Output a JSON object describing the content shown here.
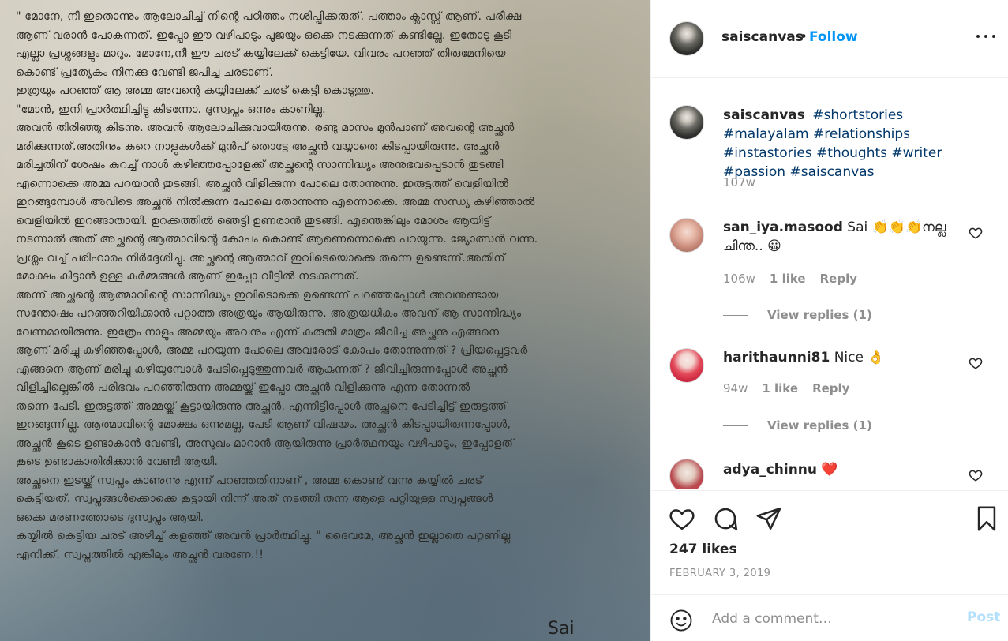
{
  "post": {
    "poem_lines": [
      "\" മോനേ, നീ ഇതൊന്നും ആലോചിച്ച് നിന്റെ പഠിത്തം നശിപ്പിക്കരുത്. പത്താം ക്ലാസ്സ് ആണ്. പരീക്ഷ",
      "ആണ് വരാൻ പോകുന്നത്. ഇപ്പോ ഈ വഴിപാടും പൂജയും ഒക്കെ നടക്കുന്നത് കണ്ടില്ലേ. ഇതോടു കൂടി",
      "എല്ലാ പ്രശ്നങ്ങളും മാറും. മോനേ,നീ ഈ ചരട് കയ്യിലേക്ക് കെട്ടിയേ. വിവരം പറഞ്ഞ് തിരുമേനിയെ",
      "കൊണ്ട് പ്രത്യേകം നിനക്കു വേണ്ടി ജപിച്ച ചരടാണ്.",
      "ഇത്രയും പറഞ്ഞ് ആ അമ്മ അവന്റെ കയ്യിലേക്ക് ചരട് കെട്ടി കൊടുത്തു.",
      "\"മോൻ, ഇനി പ്രാർത്ഥിച്ചിട്ടു കിടന്നോ. ദുസ്വപ്നം ഒന്നും കാണില്ല.",
      "അവൻ തിരിഞ്ഞു കിടന്നു. അവൻ ആലോചിക്കുവായിരുന്നു. രണ്ടു മാസം മുൻപാണ് അവന്റെ അച്ഛൻ",
      "മരിക്കുന്നത്.അതിനും കുറെ നാളുകൾക്ക് മുൻപ് തൊട്ടേ അച്ഛൻ വയ്യാതെ കിടപ്പായിരുന്നു. അച്ഛൻ",
      "മരിച്ചതിന് ശേഷം കുറച്ച് നാൾ കഴിഞ്ഞപ്പോളേക്ക് അച്ഛന്റെ സാന്നിദ്ധ്യം അനുഭവപ്പെടാൻ തുടങ്ങി",
      "എന്നൊക്കെ അമ്മ പറയാൻ തുടങ്ങി. അച്ഛൻ വിളിക്കുന്ന പോലെ തോന്നുന്നു. ഇരുട്ടത്ത് വെളിയിൽ",
      "ഇറങ്ങുമ്പോൾ അവിടെ അച്ഛൻ നിൽക്കുന്ന പോലെ തോന്നുന്നു എന്നൊക്കെ. അമ്മ സന്ധ്യ കഴിഞ്ഞാൽ",
      "വെളിയിൽ ഇറങ്ങാതായി. ഉറക്കത്തിൽ ഞെട്ടി ഉണരാൻ തുടങ്ങി. എന്തെങ്കിലും മോശം ആയിട്ട്",
      "നടന്നാൽ അത് അച്ഛന്റെ ആത്മാവിന്റെ കോപം കൊണ്ട് ആണെന്നൊക്കെ പറയുന്നു. ജ്യോത്സൻ വന്നു.",
      "പ്രശ്നം വച്ച് പരിഹാരം നിർദ്ദേശിച്ചു. അച്ഛന്റെ ആത്മാവ് ഇവിടെയൊക്കെ തന്നെ ഉണ്ടെന്ന്.അതിന്",
      "മോക്ഷം കിട്ടാൻ ഉള്ള കർമ്മങ്ങൾ ആണ് ഇപ്പോ വീട്ടിൽ നടക്കുന്നത്.",
      "അന്ന് അച്ഛന്റെ ആത്മാവിന്റെ സാന്നിദ്ധ്യം ഇവിടൊക്കെ ഉണ്ടെന്ന് പറഞ്ഞപ്പോൾ അവനുണ്ടായ",
      "സന്തോഷം പറഞ്ഞറിയിക്കാൻ പറ്റാത്ത അത്രയും ആയിരുന്നു. അത്രയധികം അവന് ആ സാന്നിദ്ധ്യം",
      "വേണമായിരുന്നു. ഇത്രേം നാളും അമ്മയും അവനും എന്ന് കരുതി മാത്രം ജീവിച്ച അച്ഛനു എങ്ങനെ",
      "ആണ് മരിച്ചു കഴിഞ്ഞപ്പോൾ, അമ്മ പറയുന്ന പോലെ അവരോട് കോപം തോന്നുന്നത് ? പ്രിയപ്പെട്ടവർ",
      "എങ്ങനെ ആണ് മരിച്ചു കഴിയുമ്പോൾ പേടിപ്പെടുത്തുന്നവർ ആകുന്നത് ? ജീവിച്ചിരുന്നപ്പോൾ അച്ഛൻ",
      "വിളിച്ചില്ലെങ്കിൽ പരിഭവം പറഞ്ഞിരുന്ന അമ്മയ്ക്ക് ഇപ്പോ അച്ഛൻ വിളിക്കുന്നു എന്ന തോന്നൽ",
      "തന്നെ പേടി. ഇരുട്ടത്ത് അമ്മയ്ക്ക് കൂട്ടായിരുന്നു അച്ഛൻ. എന്നിട്ടിപ്പോൾ അച്ഛനെ പേടിച്ചിട്ട് ഇരുട്ടത്ത്",
      "ഇറങ്ങുന്നില്ല. ആത്മാവിന്റെ മോക്ഷം ഒന്നുമല്ല, പേടി ആണ് വിഷയം. അച്ഛൻ കിടപ്പായിരുന്നപ്പോൾ,",
      "അച്ഛൻ കൂടെ ഉണ്ടാകാൻ വേണ്ടി, അസുഖം മാറാൻ ആയിരുന്നു പ്രാർത്ഥനയും വഴിപാടും, ഇപ്പോളത്",
      "കൂടെ ഉണ്ടാകാതിരിക്കാൻ വേണ്ടി ആയി.",
      "അച്ഛനെ ഇടയ്ക്ക് സ്വപ്നം കാണുന്നു എന്ന് പറഞ്ഞതിനാണ് , അമ്മ കൊണ്ട് വന്നു കയ്യിൽ ചരട്",
      "കെട്ടിയത്. സ്വപ്നങ്ങൾക്കൊക്കെ കൂട്ടായി നിന്ന് അത് നടത്തി തന്ന ആളെ പറ്റിയുള്ള സ്വപ്നങ്ങൾ",
      "ഒക്കെ മരണത്തോടെ ദുസ്വപ്നം ആയി.",
      "കയ്യിൽ കെട്ടിയ ചരട് അഴിച്ച് കളഞ്ഞ് അവൻ പ്രാർത്ഥിച്ചു. \" ദൈവമേ, അച്ഛൻ ഇല്ലാതെ പറ്റണില്ല",
      "എനിക്ക്. സ്വപ്നത്തിൽ എങ്കിലും അച്ഛൻ വരണേ.!!"
    ],
    "signature": "Sai"
  },
  "header": {
    "username": "saiscanvas",
    "dot": "•",
    "follow_label": "Follow",
    "more_icon": "more-horizontal-icon"
  },
  "caption": {
    "username": "saiscanvas",
    "hashtags": [
      "#shortstories",
      "#malayalam",
      "#relationships",
      "#instastories",
      "#thoughts",
      "#writer",
      "#passion",
      "#saiscanvas"
    ],
    "time": "107w"
  },
  "comments": [
    {
      "username": "san_iya.masood",
      "text": "Sai 👏👏👏നല്ല ചിന്ത.. 😀",
      "time": "106w",
      "likes": "1 like",
      "reply_label": "Reply",
      "view_replies": "View replies (1)"
    },
    {
      "username": "harithaunni81",
      "text": "Nice 👌",
      "time": "94w",
      "likes": "1 like",
      "reply_label": "Reply",
      "view_replies": "View replies (1)"
    },
    {
      "username": "adya_chinnu",
      "text": "❤️"
    }
  ],
  "actions": {
    "like_icon": "heart-icon",
    "comment_icon": "comment-icon",
    "share_icon": "share-icon",
    "save_icon": "bookmark-icon",
    "likes_count": "247 likes",
    "date": "FEBRUARY 3, 2019"
  },
  "add_comment": {
    "emoji_icon": "emoji-icon",
    "placeholder": "Add a comment…",
    "post_label": "Post"
  },
  "colors": {
    "accent": "#0095f6",
    "hashtag": "#00376b",
    "muted": "#8e8e8e",
    "post_disabled": "#b2dffc"
  }
}
